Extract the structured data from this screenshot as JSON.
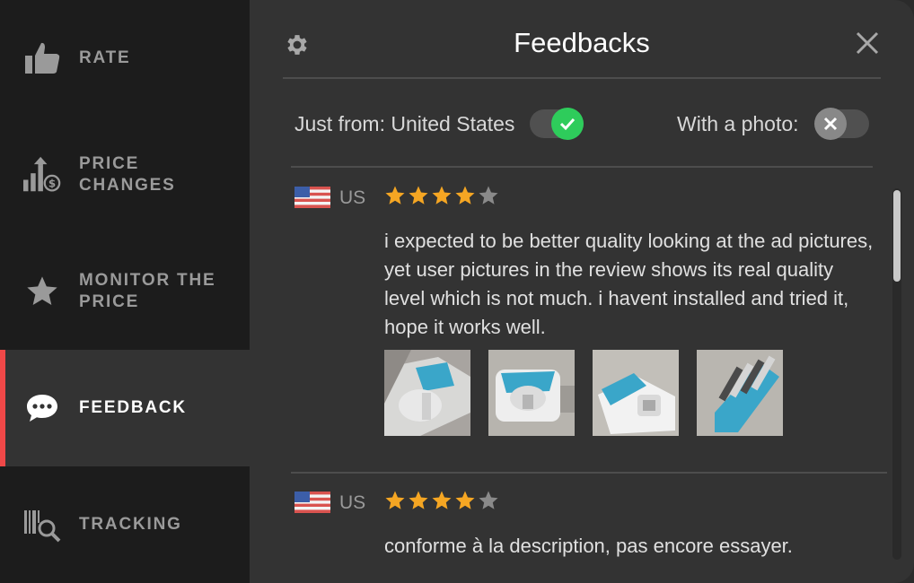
{
  "sidebar": {
    "items": [
      {
        "label": "RATE",
        "icon": "thumbs-up-icon",
        "active": false
      },
      {
        "label": "PRICE\nCHANGES",
        "icon": "price-changes-icon",
        "active": false
      },
      {
        "label": "MONITOR THE\nPRICE",
        "icon": "star-icon",
        "active": false
      },
      {
        "label": "FEEDBACK",
        "icon": "chat-bubble-icon",
        "active": true
      },
      {
        "label": "TRACKING",
        "icon": "barcode-search-icon",
        "active": false
      }
    ],
    "accent_color": "#f04848"
  },
  "panel": {
    "title": "Feedbacks",
    "filters": {
      "country_label": "Just from: United States",
      "country_on": true,
      "photo_label": "With a photo:",
      "photo_on": false
    }
  },
  "reviews": [
    {
      "country": "US",
      "rating": 4,
      "max_rating": 5,
      "text": "i expected to be better quality looking at the ad pictures, yet user pictures in the review shows its real quality level which is not much. i havent installed and tried it, hope it works well.",
      "photos": [
        "review-photo-1",
        "review-photo-2",
        "review-photo-3",
        "review-photo-4"
      ]
    },
    {
      "country": "US",
      "rating": 4,
      "max_rating": 5,
      "text": "conforme à la description, pas encore essayer.",
      "photos": []
    }
  ],
  "colors": {
    "star_filled": "#f5a623",
    "star_empty": "#8a8a8a",
    "toggle_on": "#2ecc5b",
    "toggle_off": "#888888"
  }
}
